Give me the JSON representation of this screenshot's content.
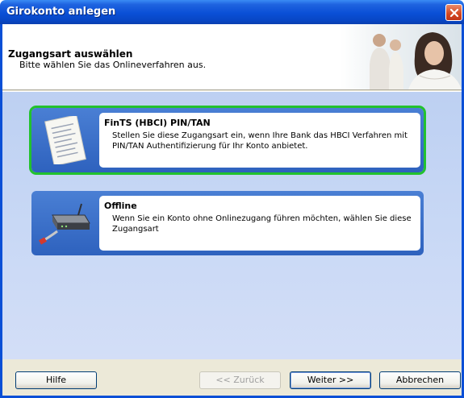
{
  "window": {
    "title": "Girokonto anlegen"
  },
  "header": {
    "title": "Zugangsart auswählen",
    "subtitle": "Bitte wählen Sie das Onlineverfahren aus."
  },
  "options": [
    {
      "title": "FinTS (HBCI) PIN/TAN",
      "description": "Stellen Sie diese Zugangsart ein, wenn Ihre Bank das HBCI Verfahren mit PIN/TAN Authentifizierung für Ihr Konto anbietet.",
      "icon": "tan-list-icon",
      "selected": true
    },
    {
      "title": "Offline",
      "description": "Wenn Sie ein Konto ohne Onlinezugang führen möchten, wählen Sie diese Zugangsart",
      "icon": "router-cable-icon",
      "selected": false
    }
  ],
  "footer": {
    "help_label": "Hilfe",
    "back_label": "<< Zurück",
    "next_label": "Weiter >>",
    "cancel_label": "Abbrechen"
  },
  "colors": {
    "titlebar": "#0a4fd6",
    "selected_outline": "#22c22e",
    "option_blue": "#2e62be"
  }
}
